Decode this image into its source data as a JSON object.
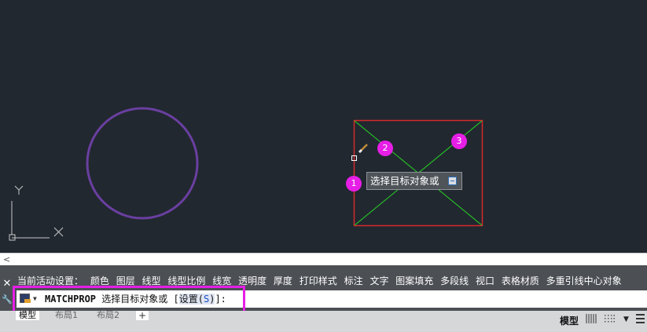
{
  "ucs": {
    "y_label": "Y",
    "x_label": "X"
  },
  "badges": [
    "1",
    "2",
    "3"
  ],
  "tooltip": {
    "text": "选择目标对象或"
  },
  "history": {
    "prefix": "当前活动设置：",
    "items": [
      "颜色",
      "图层",
      "线型",
      "线型比例",
      "线宽",
      "透明度",
      "厚度",
      "打印样式",
      "标注",
      "文字",
      "图案填充",
      "多段线",
      "视口",
      "表格材质",
      "多重引线中心对象"
    ]
  },
  "command": {
    "name": "MATCHPROP",
    "prompt": "选择目标对象或 ",
    "option_open": "[",
    "option_label": "设置(",
    "option_key": "S",
    "option_close": ")",
    "suffix": "]:"
  },
  "side_buttons": {
    "close": "✕",
    "wrench": "🔧"
  },
  "scroll_arrow": "<",
  "tabs": [
    "模型",
    "布局1",
    "布局2"
  ],
  "tab_add": "+",
  "status": {
    "model": "模型"
  },
  "colors": {
    "canvas": "#212830",
    "circle": "#6a3fa0",
    "rect": "#d42a2a",
    "diagonal": "#26b826",
    "highlight": "#e61ee6"
  }
}
